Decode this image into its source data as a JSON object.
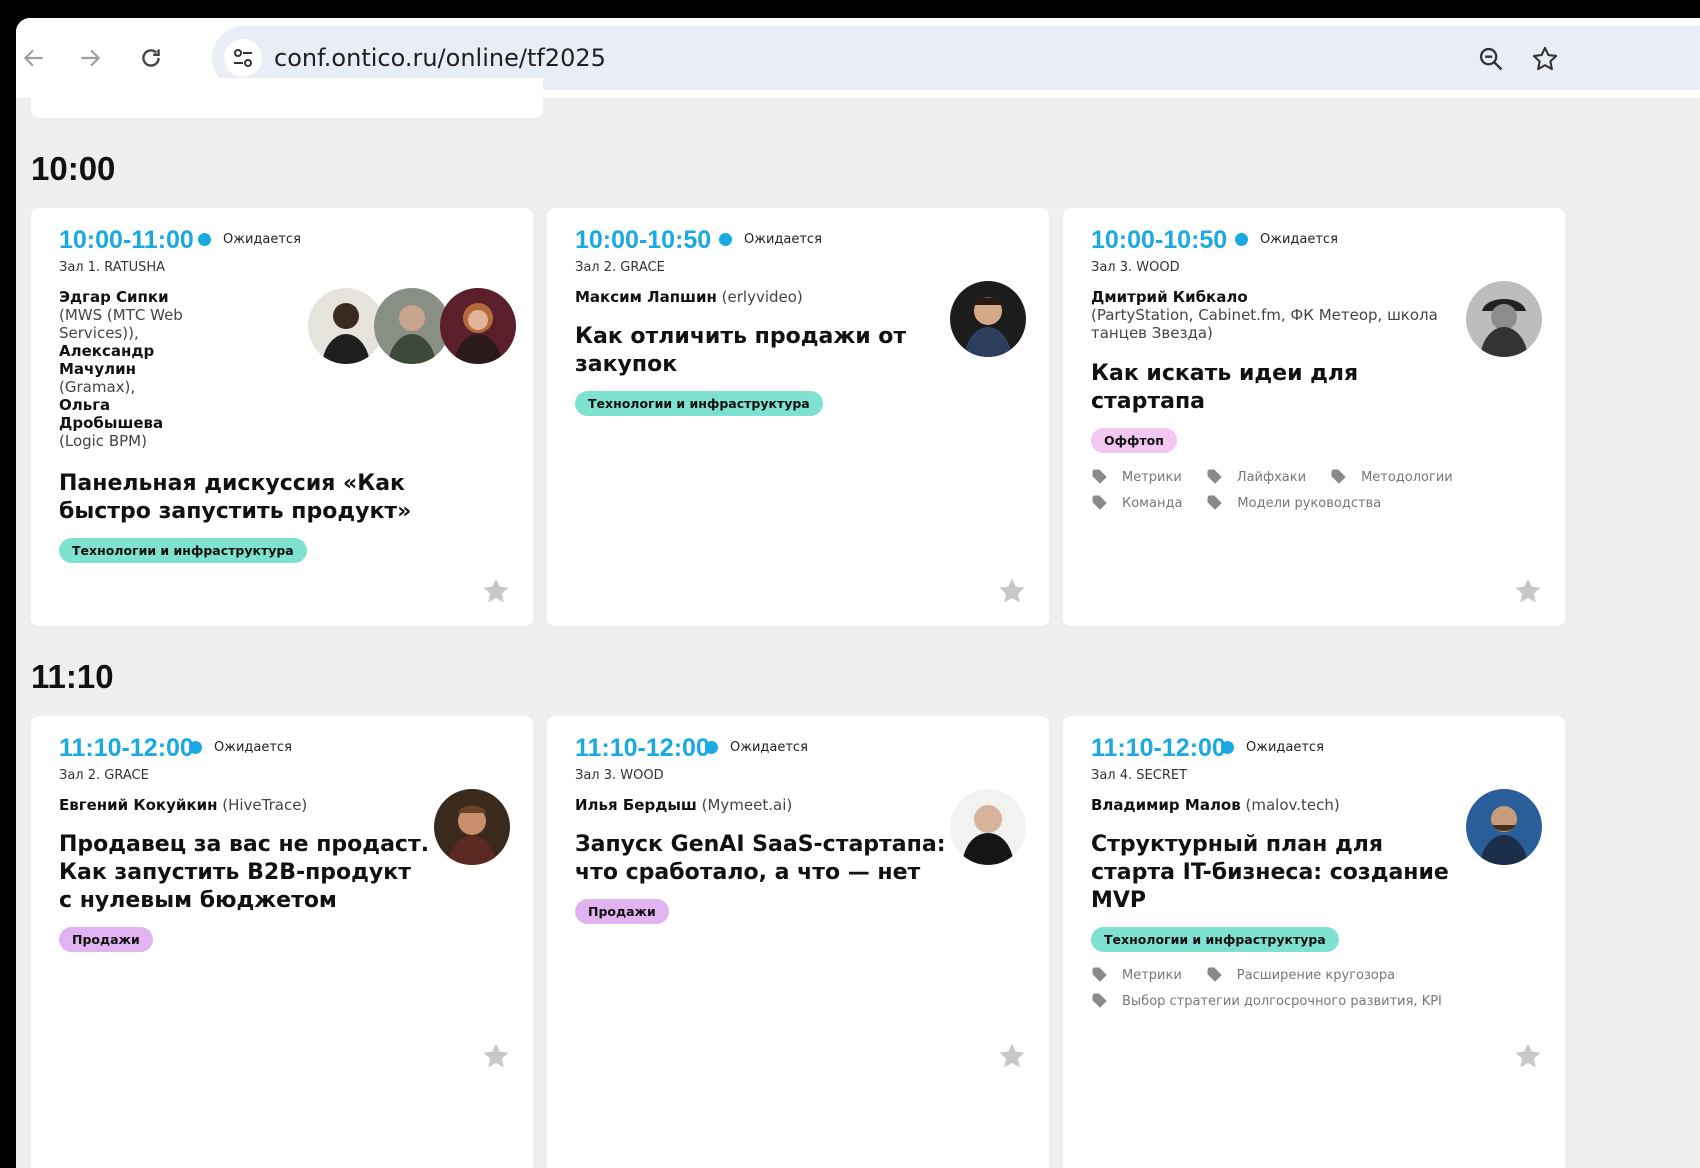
{
  "browser": {
    "url": "conf.ontico.ru/online/tf2025"
  },
  "slots": [
    {
      "time": "10:00",
      "cards": [
        {
          "time": "10:00-11:00",
          "status": "Ожидается",
          "room": "Зал 1. RATUSHA",
          "speakers": [
            {
              "name_lines": [
                "Эдгар Сипки"
              ],
              "org_lines": [
                "(MWS (МТС Web",
                "Services)),"
              ]
            },
            {
              "name_lines": [
                "Александр",
                "Мачулин"
              ],
              "org_lines": [
                "(Gramax),"
              ]
            },
            {
              "name_lines": [
                "Ольга",
                "Дробышева"
              ],
              "org_lines": [
                "(Logic BPM)"
              ]
            }
          ],
          "title_lines": [
            "Панельная дискуссия «Как",
            "быстро запустить продукт»"
          ],
          "category": "Технологии и инфраструктура",
          "tags": []
        },
        {
          "time": "10:00-10:50",
          "status": "Ожидается",
          "room": "Зал 2. GRACE",
          "speaker": "Максим Лапшин",
          "org": "(erlyvideo)",
          "title_lines": [
            "Как отличить продажи от",
            "закупок"
          ],
          "category": "Технологии и инфраструктура",
          "tags": []
        },
        {
          "time": "10:00-10:50",
          "status": "Ожидается",
          "room": "Зал 3. WOOD",
          "speaker": "Дмитрий Кибкало",
          "org_lines": [
            "(PartyStation, Cabinet.fm, ФК Метеор, школа",
            "танцев Звезда)"
          ],
          "title_lines": [
            "Как искать идеи для",
            "стартапа"
          ],
          "category": "Оффтоп",
          "tags": [
            [
              "Метрики",
              "Лайфхаки",
              "Методологии"
            ],
            [
              "Команда",
              "Модели руководства"
            ]
          ]
        }
      ]
    },
    {
      "time": "11:10",
      "cards": [
        {
          "time": "11:10-12:00",
          "status": "Ожидается",
          "room": "Зал 2. GRACE",
          "speaker": "Евгений Кокуйкин",
          "org": "(HiveTrace)",
          "title_lines": [
            "Продавец за вас не продаст.",
            "Как запустить B2B-продукт",
            "с нулевым бюджетом"
          ],
          "category": "Продажи",
          "tags": []
        },
        {
          "time": "11:10-12:00",
          "status": "Ожидается",
          "room": "Зал 3. WOOD",
          "speaker": "Илья Бердыш",
          "org": "(Mymeet.ai)",
          "title_lines": [
            "Запуск GenAI SaaS-стартапа:",
            "что сработало, а что — нет"
          ],
          "category": "Продажи",
          "tags": []
        },
        {
          "time": "11:10-12:00",
          "status": "Ожидается",
          "room": "Зал 4. SECRET",
          "speaker": "Владимир Малов",
          "org": "(malov.tech)",
          "title_lines": [
            "Структурный план для",
            "старта IT-бизнеса: создание",
            "MVP"
          ],
          "category": "Технологии и инфраструктура",
          "tags": [
            [
              "Метрики",
              "Расширение кругозора"
            ],
            [
              "Выбор стратегии долгосрочного развития, KPI"
            ]
          ]
        }
      ]
    }
  ],
  "colors": {
    "accent": "#1aa9e0",
    "pill_teal": "#7fe1d0",
    "pill_pink": "#f3c7f1",
    "pill_purple": "#e2b3f1",
    "page_bg": "#efefef"
  },
  "icons": [
    "back-arrow-icon",
    "forward-arrow-icon",
    "reload-icon",
    "site-settings-icon",
    "zoom-icon",
    "bookmark-star-icon",
    "tag-icon",
    "favorite-star-icon"
  ]
}
